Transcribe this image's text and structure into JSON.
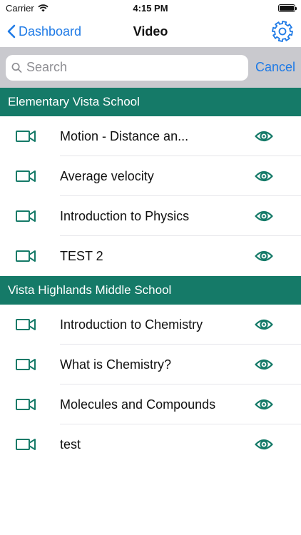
{
  "status": {
    "carrier": "Carrier",
    "time": "4:15 PM",
    "battery_level": 1.0
  },
  "nav": {
    "back_label": "Dashboard",
    "title": "Video"
  },
  "search": {
    "placeholder": "Search",
    "value": "",
    "cancel_label": "Cancel"
  },
  "colors": {
    "accent": "#157a68",
    "link": "#1e7ae6",
    "search_bg": "#c9c9ce"
  },
  "sections": [
    {
      "header": "Elementary Vista School",
      "items": [
        {
          "title": "Motion - Distance an...",
          "icon": "video-camera-icon",
          "action_icon": "eye-icon"
        },
        {
          "title": "Average velocity",
          "icon": "video-camera-icon",
          "action_icon": "eye-icon"
        },
        {
          "title": "Introduction to Physics",
          "icon": "video-camera-icon",
          "action_icon": "eye-icon"
        },
        {
          "title": "TEST 2",
          "icon": "video-camera-icon",
          "action_icon": "eye-icon"
        }
      ]
    },
    {
      "header": "Vista Highlands Middle School",
      "items": [
        {
          "title": "Introduction to Chemistry",
          "icon": "video-camera-icon",
          "action_icon": "eye-icon"
        },
        {
          "title": "What is Chemistry?",
          "icon": "video-camera-icon",
          "action_icon": "eye-icon"
        },
        {
          "title": "Molecules and Compounds",
          "icon": "video-camera-icon",
          "action_icon": "eye-icon"
        },
        {
          "title": "test",
          "icon": "video-camera-icon",
          "action_icon": "eye-icon"
        }
      ]
    }
  ]
}
